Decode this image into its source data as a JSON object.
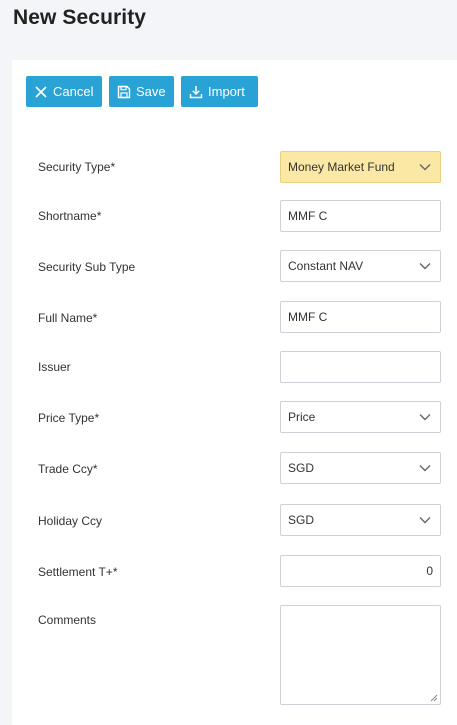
{
  "page": {
    "title": "New Security"
  },
  "toolbar": {
    "cancel_label": "Cancel",
    "save_label": "Save",
    "import_label": "Import"
  },
  "colors": {
    "accent": "#29a3d6",
    "highlight": "#fbe8a4"
  },
  "form": {
    "security_type": {
      "label": "Security Type*",
      "value": "Money Market Fund",
      "kind": "select"
    },
    "shortname": {
      "label": "Shortname*",
      "value": "MMF C",
      "kind": "input"
    },
    "security_sub_type": {
      "label": "Security Sub Type",
      "value": "Constant NAV",
      "kind": "select"
    },
    "full_name": {
      "label": "Full Name*",
      "value": "MMF C",
      "kind": "input"
    },
    "issuer": {
      "label": "Issuer",
      "value": "",
      "kind": "input"
    },
    "price_type": {
      "label": "Price Type*",
      "value": "Price",
      "kind": "select"
    },
    "trade_ccy": {
      "label": "Trade Ccy*",
      "value": "SGD",
      "kind": "select"
    },
    "holiday_ccy": {
      "label": "Holiday Ccy",
      "value": "SGD",
      "kind": "select"
    },
    "settlement": {
      "label": "Settlement T+*",
      "value": "0",
      "kind": "number"
    },
    "comments": {
      "label": "Comments",
      "value": "",
      "kind": "textarea"
    }
  }
}
